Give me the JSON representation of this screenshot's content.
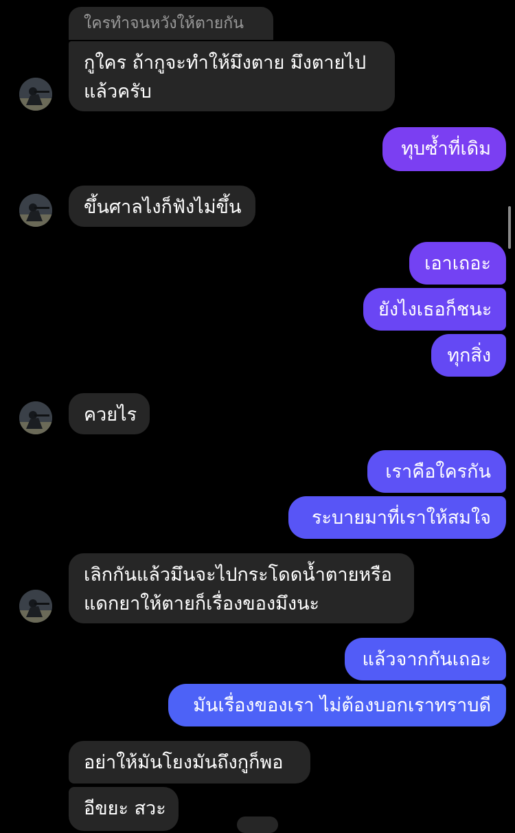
{
  "conversation": {
    "reply_preview": "ใครทำจนหวังให้ตายกัน",
    "messages": [
      {
        "sender": "them",
        "lines": [
          "กูใคร ถ้ากูจะทำให้มึงตาย มึงตายไป",
          "แล้วครับ"
        ]
      },
      {
        "sender": "me",
        "text": "ทุบซ้ำที่เดิม"
      },
      {
        "sender": "them",
        "text": "ขึ้นศาลไงก็ฟังไม่ขึ้น"
      },
      {
        "sender": "me",
        "text": "เอาเถอะ"
      },
      {
        "sender": "me",
        "text": "ยังไงเธอก็ชนะ"
      },
      {
        "sender": "me",
        "text": "ทุกสิ่ง"
      },
      {
        "sender": "them",
        "text": "ควยไร"
      },
      {
        "sender": "me",
        "text": "เราคือใครกัน"
      },
      {
        "sender": "me",
        "text": "ระบายมาที่เราให้สมใจ"
      },
      {
        "sender": "them",
        "lines": [
          "เลิกกันแล้วมึนจะไปกระโดดน้ำตายหรือ",
          "แดกยาให้ตายก็เรื่องของมึงนะ"
        ]
      },
      {
        "sender": "me",
        "text": "แล้วจากกันเถอะ"
      },
      {
        "sender": "me",
        "text": "มันเรื่องของเรา ไม่ต้องบอกเราทราบดี"
      },
      {
        "sender": "them",
        "text": "อย่าให้มันโยงมันถึงกูก็พอ"
      },
      {
        "sender": "them",
        "text": "อีขยะ สวะ"
      }
    ]
  },
  "colors": {
    "background": "#000000",
    "incoming_bubble": "#262626",
    "outgoing_gradient": [
      "#7b3ff2",
      "#6450f5",
      "#4d62f7"
    ],
    "text": "#ffffff",
    "muted_text": "#9a9a9a"
  },
  "icons": {
    "avatar": "avatar-photo-icon"
  }
}
